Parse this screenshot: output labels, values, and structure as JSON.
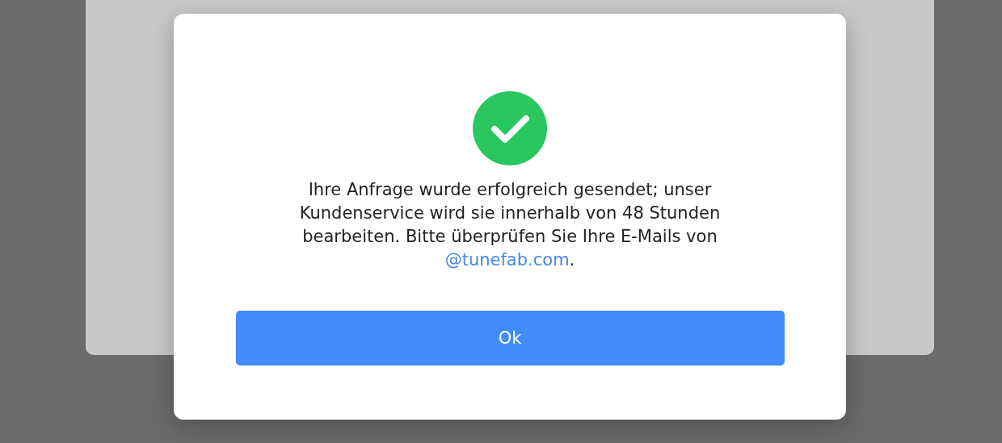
{
  "dialog": {
    "succeeded": true,
    "message_lines": [
      "Ihre Anfrage wurde erfolgreich gesendet; unser",
      "Kundenservice wird sie innerhalb von 48 Stunden",
      "bearbeiten. Bitte überprüfen Sie Ihre E-Mails von"
    ],
    "link": "@tunefab.com",
    "after_link": ".",
    "button": "Ok"
  }
}
